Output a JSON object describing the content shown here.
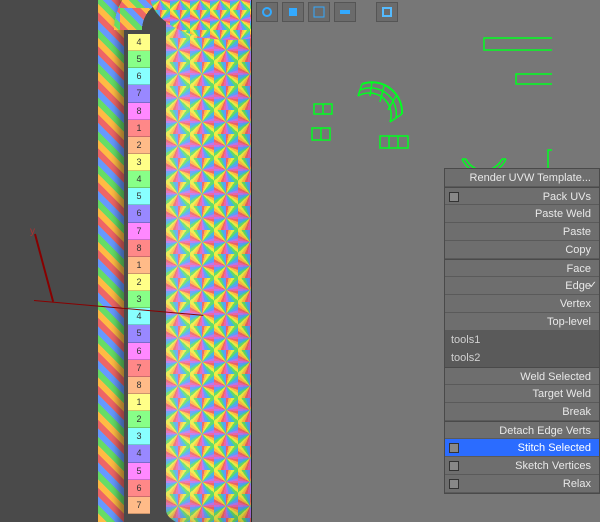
{
  "toolbar": {
    "icons": [
      "loop-icon",
      "face-icon",
      "element-icon",
      "vertex-icon",
      "options-icon",
      "gap",
      "region-icon"
    ]
  },
  "context_menu": {
    "items": [
      {
        "label": "Render UVW Template...",
        "type": "cmd"
      },
      {
        "label": "Pack UVs",
        "type": "cmd",
        "sq": true,
        "sep": true
      },
      {
        "label": "Paste Weld",
        "type": "cmd"
      },
      {
        "label": "Paste",
        "type": "cmd"
      },
      {
        "label": "Copy",
        "type": "cmd"
      },
      {
        "label": "Face",
        "type": "mode",
        "sep": true
      },
      {
        "label": "Edge",
        "type": "mode",
        "check": true
      },
      {
        "label": "Vertex",
        "type": "mode"
      },
      {
        "label": "Top-level",
        "type": "mode"
      },
      {
        "label": "tools1",
        "type": "tool"
      },
      {
        "label": "tools2",
        "type": "tool"
      },
      {
        "label": "Weld Selected",
        "type": "cmd",
        "sep": true
      },
      {
        "label": "Target Weld",
        "type": "cmd"
      },
      {
        "label": "Break",
        "type": "cmd"
      },
      {
        "label": "Detach Edge Verts",
        "type": "cmd",
        "sep": true
      },
      {
        "label": "Stitch Selected",
        "type": "cmd",
        "hl": true,
        "sq": true
      },
      {
        "label": "Sketch Vertices",
        "type": "cmd",
        "sq": true
      },
      {
        "label": "Relax",
        "type": "cmd",
        "sq": true
      }
    ]
  },
  "axis": {
    "y_label": "y"
  },
  "ruler_digits": [
    "4",
    "5",
    "6",
    "7",
    "8",
    "1",
    "2",
    "3",
    "4",
    "5",
    "6",
    "7",
    "8",
    "1",
    "2",
    "3",
    "4",
    "5",
    "6",
    "7",
    "8",
    "1",
    "2",
    "3",
    "4",
    "5",
    "6",
    "7"
  ],
  "ruler_colors": [
    "#ff8",
    "#8f8",
    "#8ff",
    "#98f",
    "#f8f",
    "#f88",
    "#fb8",
    "#ff8",
    "#8f8",
    "#8ff",
    "#98f",
    "#f8f",
    "#f88",
    "#fb8",
    "#ff8",
    "#8f8",
    "#8ff",
    "#98f",
    "#f8f",
    "#f88",
    "#fb8",
    "#ff8",
    "#8f8",
    "#8ff",
    "#98f",
    "#f8f",
    "#f88",
    "#fb8"
  ]
}
